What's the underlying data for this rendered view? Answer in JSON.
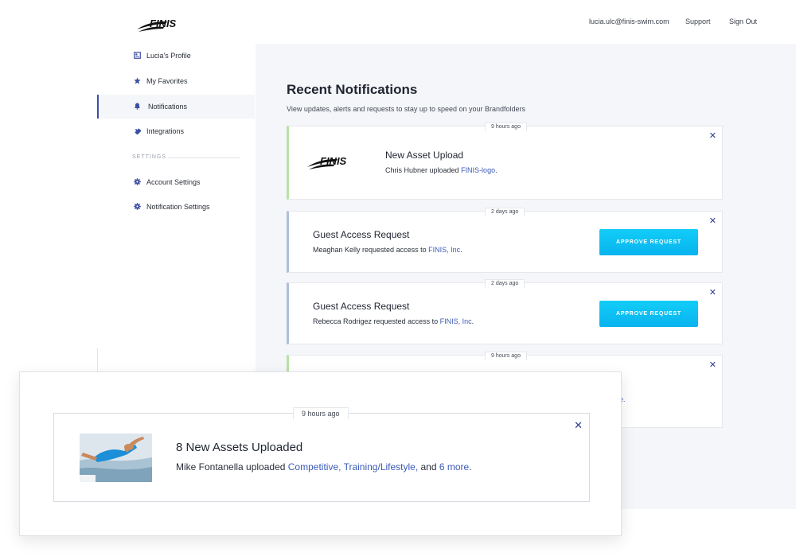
{
  "header": {
    "brand": "FINIS",
    "email": "lucia.ulc@finis-swim.com",
    "support": "Support",
    "sign_out": "Sign Out"
  },
  "sidebar": {
    "items": [
      {
        "label": "Lucia's Profile",
        "icon": "profile-icon"
      },
      {
        "label": "My Favorites",
        "icon": "star-icon"
      },
      {
        "label": "Notifications",
        "icon": "bell-icon",
        "active": true
      },
      {
        "label": "Integrations",
        "icon": "puzzle-icon"
      }
    ],
    "settings_heading": "SETTINGS",
    "settings_items": [
      {
        "label": "Account Settings",
        "icon": "gear-icon"
      },
      {
        "label": "Notification Settings",
        "icon": "gear-icon"
      }
    ]
  },
  "main": {
    "title": "Recent Notifications",
    "subtitle": "View updates, alerts and requests to stay up to speed on your Brandfolders"
  },
  "notifications": [
    {
      "time": "9 hours ago",
      "title": "New Asset Upload",
      "body_prefix": "Chris Hubner uploaded ",
      "link": "FINIS-logo",
      "body_suffix": "."
    },
    {
      "time": "2 days ago",
      "title": "Guest Access Request",
      "body_prefix": "Meaghan Kelly requested access to ",
      "link": "FINIS, Inc",
      "body_suffix": ".",
      "action": "APPROVE REQUEST"
    },
    {
      "time": "2 days ago",
      "title": "Guest Access Request",
      "body_prefix": "Rebecca Rodrigez requested access to ",
      "link": "FINIS, Inc",
      "body_suffix": ".",
      "action": "APPROVE REQUEST"
    },
    {
      "time": "9 hours ago",
      "partial_text": "ore."
    }
  ],
  "featured": {
    "time": "9 hours ago",
    "title": "8 New Assets Uploaded",
    "body_prefix": "Mike Fontanella uploaded ",
    "link1": "Competitive, Training/Lifestyle,",
    "middle": " and ",
    "link2": "6 more",
    "body_suffix": "."
  },
  "colors": {
    "accent": "#3b5ab7",
    "button": "#0fc3f5",
    "asset_border": "#b7e2a4",
    "request_border": "#aebfdc",
    "panel_bg": "#f5f6f9"
  }
}
